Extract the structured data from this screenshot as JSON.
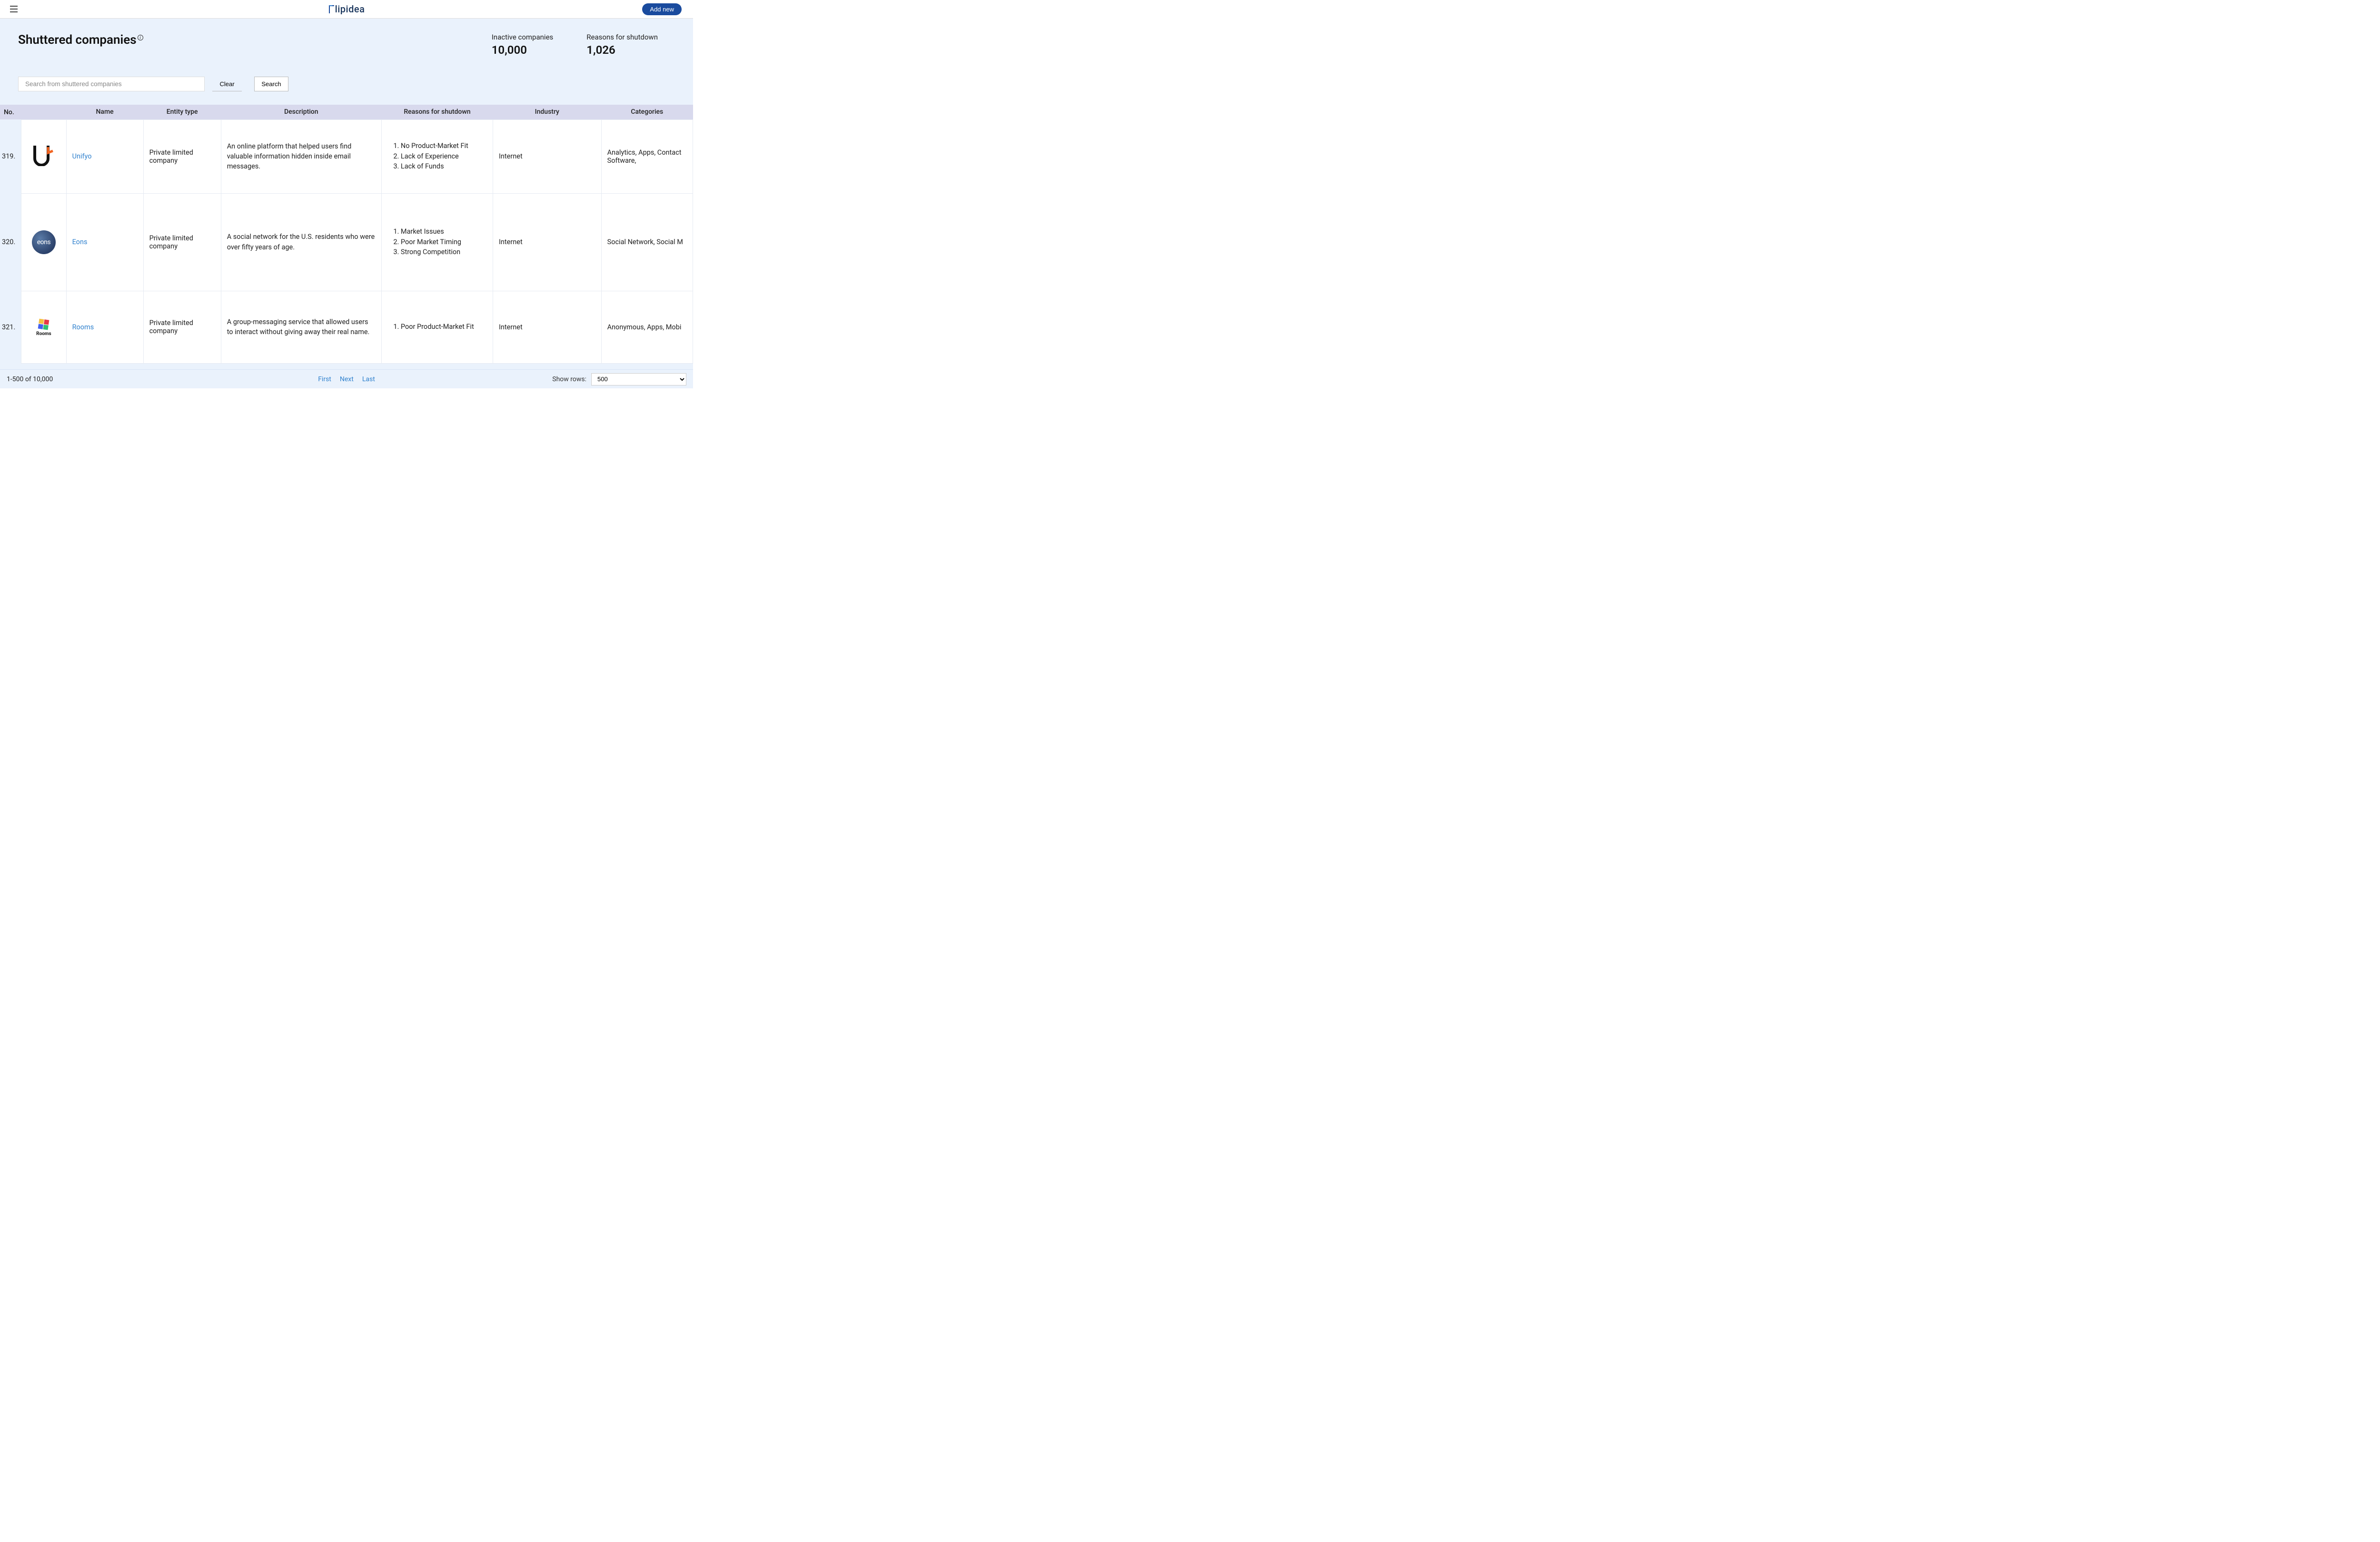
{
  "header": {
    "logo": "lipidea",
    "addnew": "Add new"
  },
  "page": {
    "title": "Shuttered companies"
  },
  "stats": {
    "inactive_label": "Inactive companies",
    "inactive_value": "10,000",
    "reasons_label": "Reasons for shutdown",
    "reasons_value": "1,026"
  },
  "search": {
    "placeholder": "Search from shuttered companies",
    "clear": "Clear",
    "search": "Search"
  },
  "table": {
    "headers": {
      "no": "No.",
      "name": "Name",
      "entity": "Entity type",
      "desc": "Description",
      "reasons": "Reasons for shutdown",
      "industry": "Industry",
      "categories": "Categories"
    },
    "rows": [
      {
        "no": "319.",
        "name": "Unifyo",
        "entity": "Private limited company",
        "desc": "An online platform that helped users find valuable information hidden inside email messages.",
        "reasons": [
          "No Product-Market Fit",
          "Lack of Experience",
          "Lack of Funds"
        ],
        "industry": "Internet",
        "categories": "Analytics, Apps, Contact Software,"
      },
      {
        "no": "320.",
        "name": "Eons",
        "entity": "Private limited company",
        "desc": "A social network for the U.S. residents who were over fifty years of age.",
        "reasons": [
          "Market Issues",
          "Poor Market Timing",
          "Strong Competition"
        ],
        "industry": "Internet",
        "categories": "Social Network, Social M"
      },
      {
        "no": "321.",
        "name": "Rooms",
        "entity": "Private limited company",
        "desc": "A group-messaging service that allowed users to interact without giving away their real name.",
        "reasons": [
          "Poor Product-Market Fit"
        ],
        "industry": "Internet",
        "categories": "Anonymous, Apps, Mobi"
      }
    ]
  },
  "footer": {
    "range": "1-500 of 10,000",
    "first": "First",
    "next": "Next",
    "last": "Last",
    "show_rows_label": "Show rows:",
    "show_rows_value": "500"
  },
  "logos": {
    "eons_text": "eons",
    "rooms_text": "Rooms"
  }
}
